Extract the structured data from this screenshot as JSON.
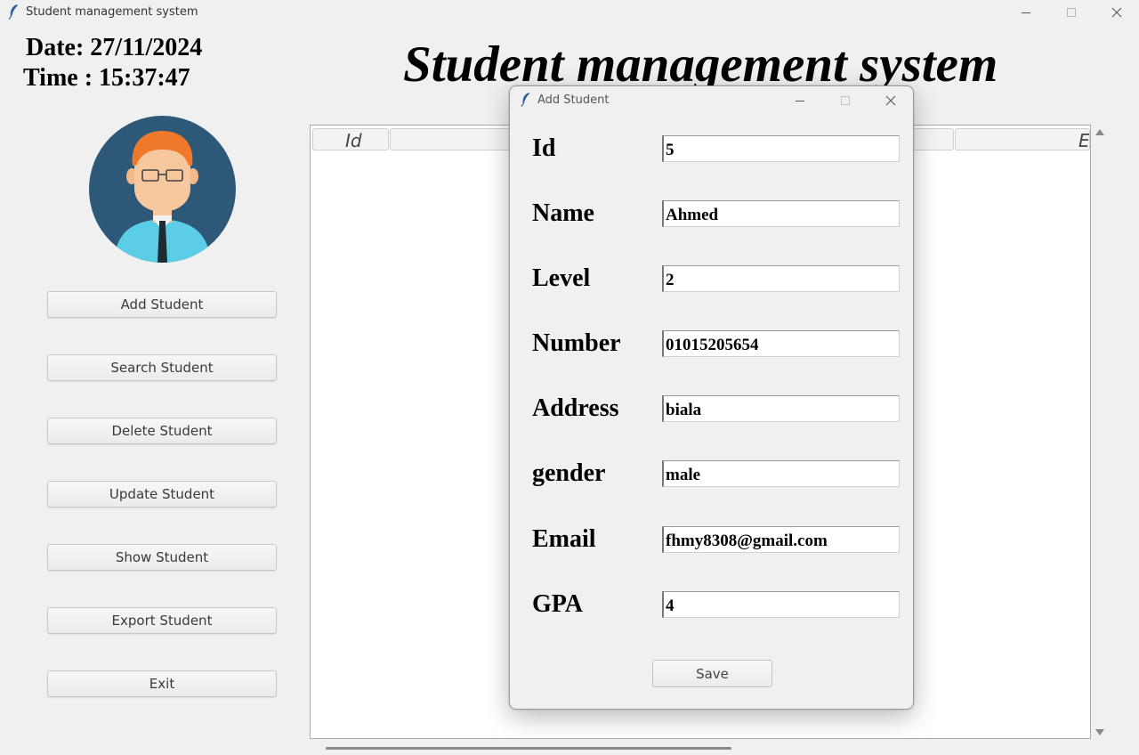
{
  "window": {
    "title": "Student management system",
    "controls": [
      "minimize-icon",
      "maximize-icon",
      "close-icon"
    ]
  },
  "header": {
    "date": "Date: 27/11/2024",
    "time": "Time : 15:37:47",
    "heading": "Student management system"
  },
  "sidebar": {
    "buttons": [
      {
        "label": "Add Student"
      },
      {
        "label": "Search Student"
      },
      {
        "label": "Delete Student"
      },
      {
        "label": "Update Student"
      },
      {
        "label": "Show Student"
      },
      {
        "label": "Export Student"
      },
      {
        "label": "Exit"
      }
    ]
  },
  "table": {
    "visible_headers": [
      "Id",
      "E"
    ]
  },
  "dialog": {
    "title": "Add Student",
    "fields": [
      {
        "label": "Id",
        "value": "5"
      },
      {
        "label": "Name",
        "value": "Ahmed"
      },
      {
        "label": "Level",
        "value": "2"
      },
      {
        "label": "Number",
        "value": "01015205654"
      },
      {
        "label": "Address",
        "value": "biala"
      },
      {
        "label": "gender",
        "value": "male"
      },
      {
        "label": "Email",
        "value": "fhmy8308@gmail.com"
      },
      {
        "label": "GPA",
        "value": "4"
      }
    ],
    "save_label": "Save"
  },
  "colors": {
    "window_bg": "#f0f0f0",
    "avatar_bg": "#2e5878",
    "avatar_shirt": "#5ccde6",
    "avatar_hair": "#f0782a"
  }
}
